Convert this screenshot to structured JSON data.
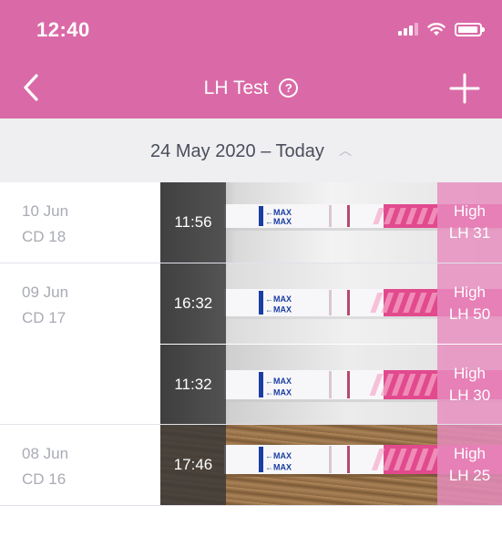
{
  "status_bar": {
    "time": "12:40"
  },
  "nav": {
    "title": "LH Test",
    "help_glyph": "?"
  },
  "range": {
    "label": "24 May 2020 – Today"
  },
  "colors": {
    "header": "#da6aa7",
    "result": "#e68cbe",
    "strip_band": "#e24a8e"
  },
  "groups": [
    {
      "date": "10 Jun",
      "cycle_day": "CD 18",
      "entries": [
        {
          "time": "11:56",
          "result": "High",
          "lh": "LH 31"
        }
      ]
    },
    {
      "date": "09 Jun",
      "cycle_day": "CD 17",
      "entries": [
        {
          "time": "16:32",
          "result": "High",
          "lh": "LH 50"
        },
        {
          "time": "11:32",
          "result": "High",
          "lh": "LH 30"
        }
      ]
    },
    {
      "date": "08 Jun",
      "cycle_day": "CD 16",
      "entries": [
        {
          "time": "17:46",
          "result": "High",
          "lh": "LH 25"
        }
      ]
    }
  ],
  "strip": {
    "marker": "←MAX"
  }
}
